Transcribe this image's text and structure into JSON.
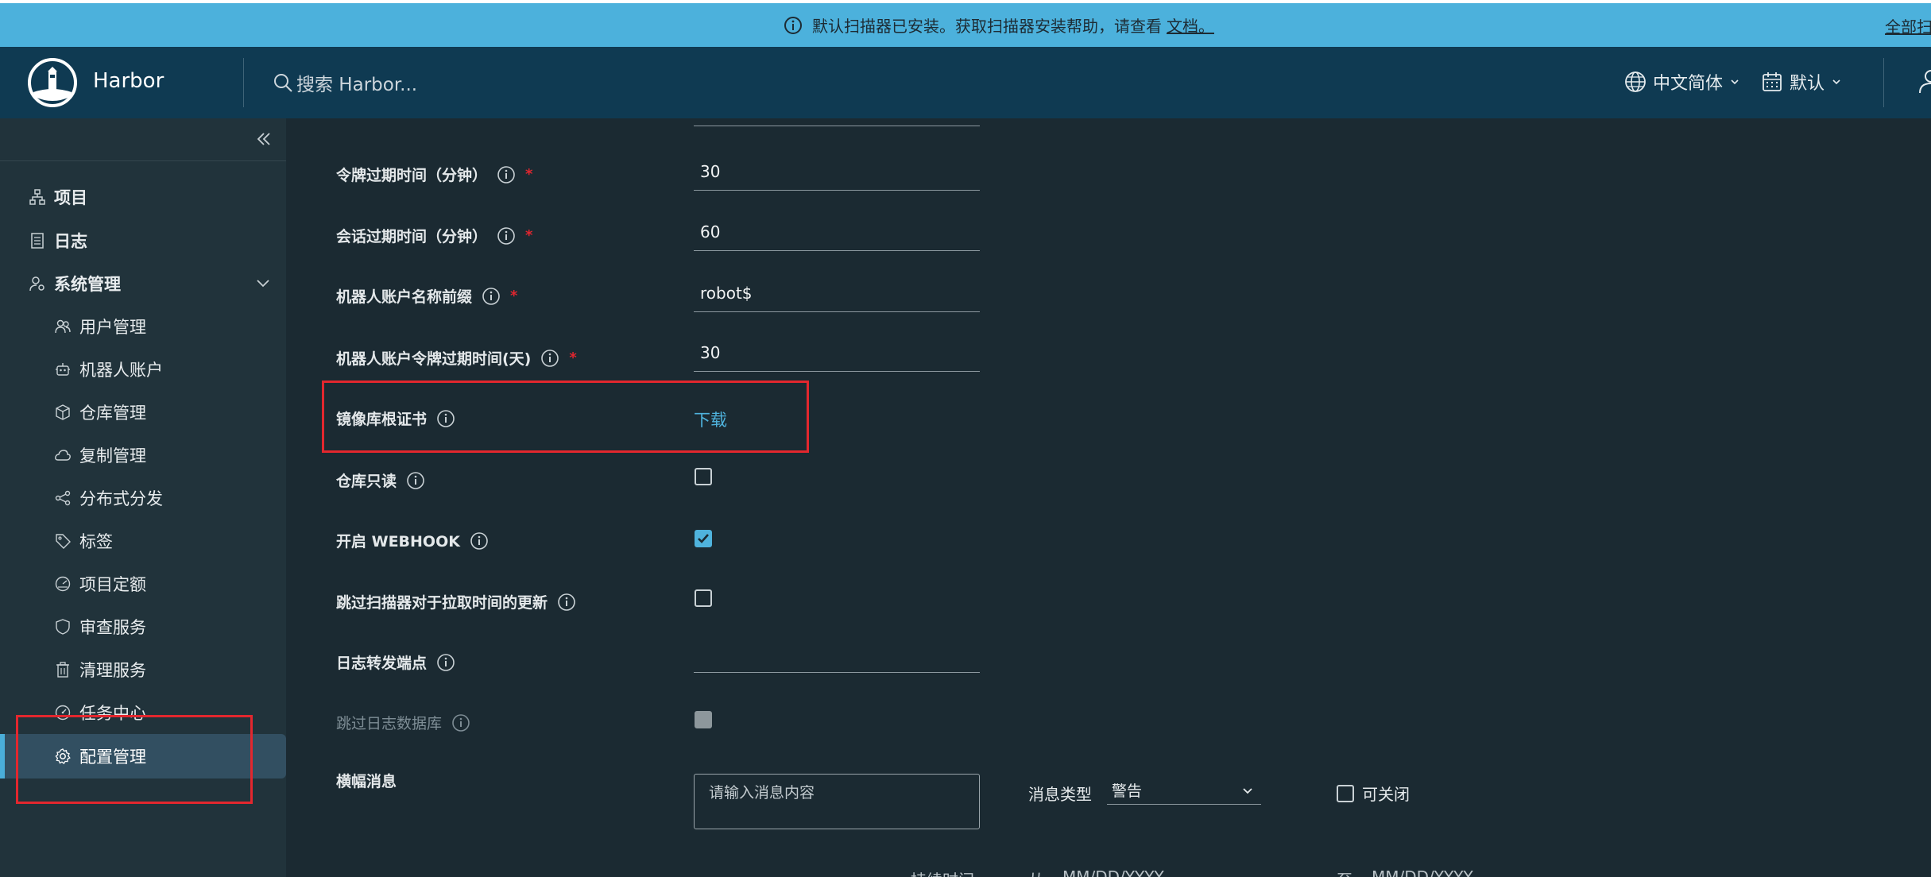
{
  "banner": {
    "message": "默认扫描器已安装。获取扫描器安装帮助，请查看",
    "link": "文档。",
    "right_link": "全部扫"
  },
  "header": {
    "brand": "Harbor",
    "search_placeholder": "搜索 Harbor...",
    "language": "中文简体",
    "theme": "默认"
  },
  "sidebar": {
    "top_items": [
      {
        "label": "项目",
        "icon": "projects-icon"
      },
      {
        "label": "日志",
        "icon": "logs-icon"
      },
      {
        "label": "系统管理",
        "icon": "admin-icon"
      }
    ],
    "sub_items": [
      {
        "label": "用户管理",
        "icon": "users-icon"
      },
      {
        "label": "机器人账户",
        "icon": "robot-icon"
      },
      {
        "label": "仓库管理",
        "icon": "registry-icon"
      },
      {
        "label": "复制管理",
        "icon": "replication-icon"
      },
      {
        "label": "分布式分发",
        "icon": "distribution-icon"
      },
      {
        "label": "标签",
        "icon": "tag-icon"
      },
      {
        "label": "项目定额",
        "icon": "quota-icon"
      },
      {
        "label": "审查服务",
        "icon": "shield-icon"
      },
      {
        "label": "清理服务",
        "icon": "trash-icon"
      },
      {
        "label": "任务中心",
        "icon": "dashboard-icon"
      },
      {
        "label": "配置管理",
        "icon": "gear-icon",
        "active": true
      }
    ]
  },
  "form": {
    "token_expire_label": "令牌过期时间（分钟）",
    "token_expire_value": "30",
    "session_expire_label": "会话过期时间（分钟）",
    "session_expire_value": "60",
    "robot_prefix_label": "机器人账户名称前缀",
    "robot_prefix_value": "robot$",
    "robot_token_expire_label": "机器人账户令牌过期时间(天)",
    "robot_token_expire_value": "30",
    "root_cert_label": "镜像库根证书",
    "root_cert_link": "下载",
    "readonly_label": "仓库只读",
    "readonly_checked": false,
    "webhook_label": "开启 WEBHOOK",
    "webhook_checked": true,
    "skip_pull_label": "跳过扫描器对于拉取时间的更新",
    "skip_pull_checked": false,
    "audit_endpoint_label": "日志转发端点",
    "audit_endpoint_value": "",
    "skip_audit_db_label": "跳过日志数据库",
    "banner_label": "横幅消息",
    "banner_placeholder": "请输入消息内容",
    "message_type_label": "消息类型",
    "message_type_value": "警告",
    "closable_label": "可关闭",
    "duration_label": "持续时间",
    "from_label": "从",
    "to_label": "至",
    "date_placeholder": "MM/DD/YYYY"
  }
}
